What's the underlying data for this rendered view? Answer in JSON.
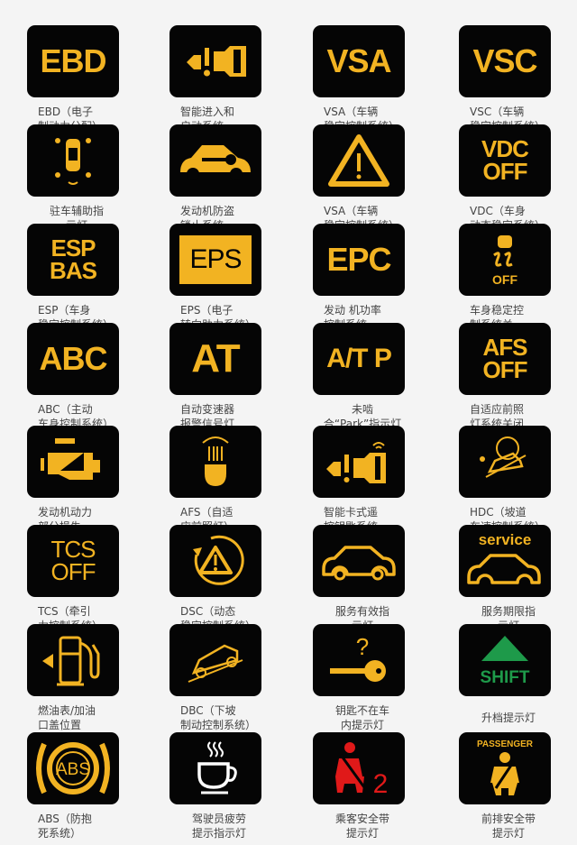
{
  "colors": {
    "amber": "#f2b322",
    "background": "#f4f4f4",
    "card": "#050505",
    "green": "#1e9a4a",
    "red": "#e01919",
    "caption": "#444444"
  },
  "items": [
    {
      "icon": "text",
      "lines": [
        "EBD"
      ],
      "caption": [
        "EBD（电子",
        "制动力分配）"
      ]
    },
    {
      "icon": "smart-entry-icon",
      "caption": [
        "智能进入和",
        "启动系统"
      ]
    },
    {
      "icon": "text",
      "lines": [
        "VSA"
      ],
      "caption": [
        "VSA（车辆",
        "稳定控制系统）"
      ]
    },
    {
      "icon": "text",
      "lines": [
        "VSC"
      ],
      "caption": [
        "VSC（车辆",
        "稳定控制系统）"
      ]
    },
    {
      "icon": "parking-assist-icon",
      "caption": [
        "驻车辅助指",
        "示灯"
      ],
      "center": true
    },
    {
      "icon": "car-key-icon",
      "caption": [
        "发动机防盗",
        "锁止系统"
      ]
    },
    {
      "icon": "warning-triangle-icon",
      "caption": [
        "VSA（车辆",
        "稳定控制系统）"
      ]
    },
    {
      "icon": "text",
      "lines": [
        "VDC",
        "OFF"
      ],
      "caption": [
        "VDC（车身",
        "动态稳定系统）"
      ]
    },
    {
      "icon": "text",
      "lines": [
        "ESP",
        "BAS"
      ],
      "caption": [
        "ESP（车身",
        "稳定控制系统）"
      ]
    },
    {
      "icon": "boxed-text",
      "lines": [
        "EPS"
      ],
      "caption": [
        "EPS（电子",
        "转向助力系统）"
      ]
    },
    {
      "icon": "text",
      "lines": [
        "EPC"
      ],
      "caption": [
        "发动 机功率",
        "控制系统"
      ]
    },
    {
      "icon": "stability-off-icon",
      "label": "OFF",
      "caption": [
        "车身稳定控",
        "制系统关"
      ]
    },
    {
      "icon": "text",
      "lines": [
        "ABC"
      ],
      "caption": [
        "ABC（主动",
        "车身控制系统）"
      ]
    },
    {
      "icon": "text",
      "lines": [
        "AT"
      ],
      "caption": [
        "自动变速器",
        "报警信号灯"
      ]
    },
    {
      "icon": "text",
      "lines": [
        "A/T P"
      ],
      "caption": [
        "未啮",
        "合“Park”指示灯"
      ],
      "center": true
    },
    {
      "icon": "text",
      "lines": [
        "AFS",
        "OFF"
      ],
      "caption": [
        "自适应前照",
        "灯系统关闭"
      ]
    },
    {
      "icon": "engine-icon",
      "caption": [
        "发动机动力",
        "部分损失"
      ]
    },
    {
      "icon": "headlight-icon",
      "caption": [
        "AFS（自适",
        "应前照灯）"
      ]
    },
    {
      "icon": "smart-key-icon",
      "caption": [
        "智能卡式遥",
        "控钥匙系统"
      ]
    },
    {
      "icon": "hill-descent-icon",
      "caption": [
        "HDC（坡道",
        "车速控制系统）"
      ]
    },
    {
      "icon": "text-thin",
      "lines": [
        "TCS",
        "OFF"
      ],
      "caption": [
        "TCS（牵引",
        "力控制系统）"
      ]
    },
    {
      "icon": "dsc-icon",
      "caption": [
        "DSC（动态",
        "稳定控制系统）"
      ]
    },
    {
      "icon": "car-outline-icon",
      "caption": [
        "服务有效指",
        "示灯"
      ],
      "center": true
    },
    {
      "icon": "service-car-icon",
      "label": "service",
      "caption": [
        "服务期限指",
        "示灯"
      ],
      "center": true
    },
    {
      "icon": "fuel-icon",
      "caption": [
        "燃油表/加油",
        "口盖位置"
      ]
    },
    {
      "icon": "downhill-brake-icon",
      "caption": [
        "DBC（下坡",
        "制动控制系统）"
      ]
    },
    {
      "icon": "key-missing-icon",
      "caption": [
        "钥匙不在车",
        "内提示灯"
      ],
      "center": true
    },
    {
      "icon": "shift-up-icon",
      "label": "SHIFT",
      "caption": [
        "升档提示灯"
      ],
      "center": true
    },
    {
      "icon": "abs-icon",
      "label": "ABS",
      "caption": [
        "ABS（防抱",
        "死系统）"
      ]
    },
    {
      "icon": "coffee-cup-icon",
      "caption": [
        "驾驶员疲劳",
        "提示指示灯"
      ],
      "center": true
    },
    {
      "icon": "seatbelt-red-icon",
      "label": "2",
      "caption": [
        "乘客安全带",
        "提示灯"
      ],
      "center": true
    },
    {
      "icon": "passenger-seatbelt-icon",
      "label": "PASSENGER",
      "caption": [
        "前排安全带",
        "提示灯"
      ],
      "center": true
    }
  ]
}
